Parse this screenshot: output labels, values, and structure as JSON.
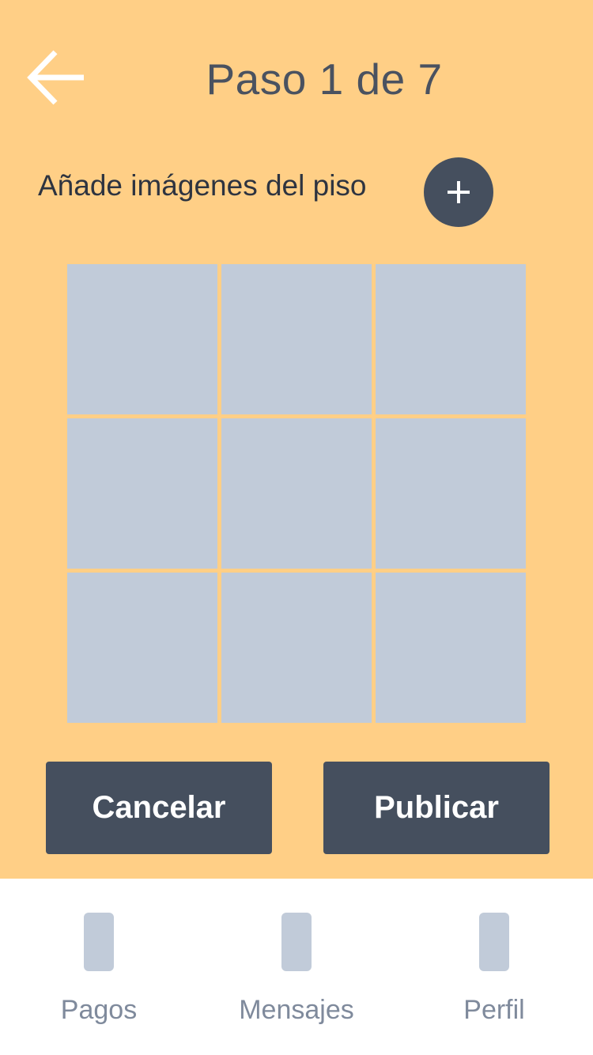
{
  "header": {
    "back_icon": "arrow-left-icon",
    "title": "Paso 1 de 7"
  },
  "images_section": {
    "label": "Añade imágenes del piso",
    "add_icon": "plus-icon",
    "slots": 9
  },
  "actions": {
    "cancel_label": "Cancelar",
    "publish_label": "Publicar"
  },
  "tabbar": {
    "items": [
      {
        "label": "Pagos",
        "icon": "placeholder-icon"
      },
      {
        "label": "Mensajes",
        "icon": "placeholder-icon"
      },
      {
        "label": "Perfil",
        "icon": "placeholder-icon"
      }
    ]
  },
  "colors": {
    "background": "#FFCF86",
    "dark": "#454F5E",
    "placeholder": "#C1CBD9",
    "tab_label": "#7F8A9C"
  }
}
